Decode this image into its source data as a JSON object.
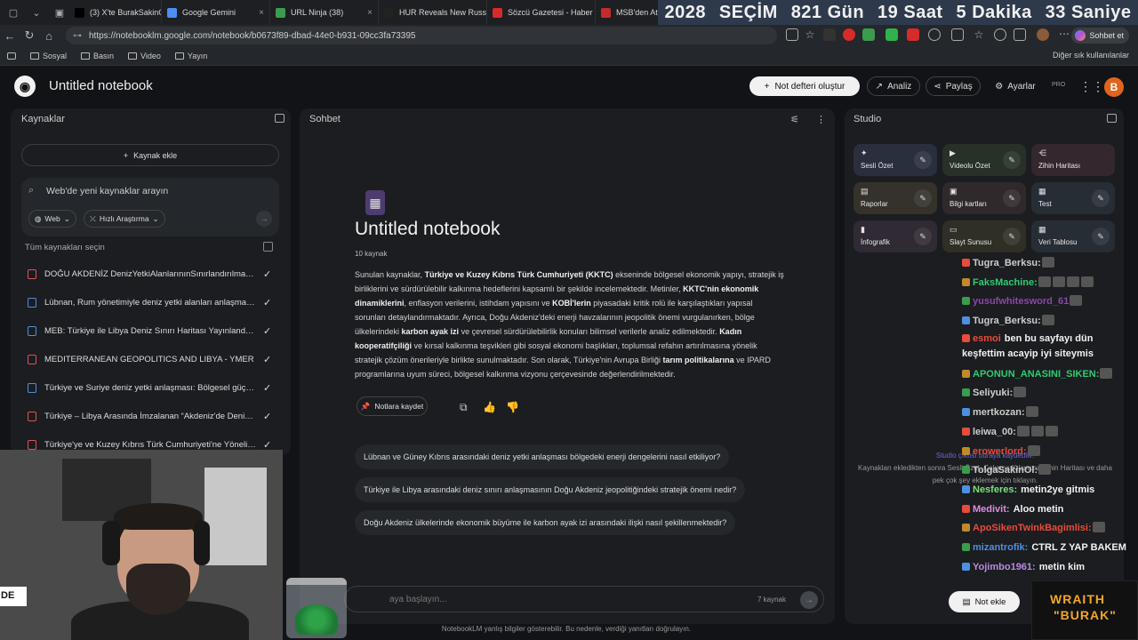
{
  "browser": {
    "tabs": [
      {
        "title": "(3) X'te BurakSakinOl: ",
        "color": "#000000"
      },
      {
        "title": "Google Gemini",
        "color": "#4c8df6"
      },
      {
        "title": "URL Ninja (38)",
        "color": "#3a9c4c"
      },
      {
        "title": "HUR Reveals New Russ",
        "color": "#222222"
      },
      {
        "title": "Sözcü Gazetesi - Haber",
        "color": "#d62b2b"
      },
      {
        "title": "MSB'den Atina'ya",
        "color": "#c42b2b"
      }
    ],
    "url": "https://notebooklm.google.com/notebook/b0673f89-dbad-44e0-b931-09cc3fa73395",
    "sohbet_label": "Sohbet et",
    "bookmarks": [
      "Sosyal",
      "Basın",
      "Video",
      "Yayın"
    ],
    "other_bookmarks": "Diğer sık kullanılanlar"
  },
  "countdown": [
    "2028",
    "SEÇİM",
    "821 Gün",
    "19 Saat",
    "5 Dakika",
    "33 Saniye"
  ],
  "header": {
    "title": "Untitled notebook",
    "create_label": "Not defteri oluştur",
    "analiz_label": "Analiz",
    "paylas_label": "Paylaş",
    "ayarlar_label": "Ayarlar",
    "pro_label": "PRO",
    "avatar_letter": "B"
  },
  "sources": {
    "title": "Kaynaklar",
    "add_label": "Kaynak ekle",
    "search_placeholder": "Web'de yeni kaynaklar arayın",
    "web_chip": "Web",
    "research_chip": "Hızlı Araştırma",
    "select_all": "Tüm kaynakları seçin",
    "items": [
      {
        "label": "DOĞU AKDENİZ DenizYetkiAlanlarınınSınırlandırılması D...",
        "type": "pdf"
      },
      {
        "label": "Lübnan, Rum yönetimiyle deniz yetki alanları anlaşması...",
        "type": "doc"
      },
      {
        "label": "MEB: Türkiye ile Libya Deniz Sınırı Haritası Yayınlandı - ...",
        "type": "doc"
      },
      {
        "label": "MEDITERRANEAN GEOPOLITICS AND LIBYA - YMER",
        "type": "pdf"
      },
      {
        "label": "Türkiye ve Suriye deniz yetki anlaşması: Bölgesel güç d...",
        "type": "doc"
      },
      {
        "label": "Türkiye – Libya Arasında İmzalanan “Akdeniz'de Deniz ...",
        "type": "pdf"
      },
      {
        "label": "Türkiye'ye ve Kuzey Kıbrıs Türk Cumhuriyeti'ne Yönelik ...",
        "type": "pdf"
      }
    ]
  },
  "chat": {
    "title": "Sohbet",
    "notebook_title": "Untitled notebook",
    "source_count": "10 kaynak",
    "summary_parts": [
      {
        "t": "Sunulan kaynaklar, ",
        "b": false
      },
      {
        "t": "Türkiye ve Kuzey Kıbrıs Türk Cumhuriyeti (KKTC)",
        "b": true
      },
      {
        "t": " ekseninde bölgesel ekonomik yapıyı, stratejik iş birliklerini ve sürdürülebilir kalkınma hedeflerini kapsamlı bir şekilde incelemektedir. Metinler, ",
        "b": false
      },
      {
        "t": "KKTC'nin ekonomik dinamiklerini",
        "b": true
      },
      {
        "t": ", enflasyon verilerini, istihdam yapısını ve ",
        "b": false
      },
      {
        "t": "KOBİ'lerin",
        "b": true
      },
      {
        "t": " piyasadaki kritik rolü ile karşılaştıkları yapısal sorunları detaylandırmaktadır. Ayrıca, Doğu Akdeniz'deki enerji havzalarının jeopolitik önemi vurgulanırken, bölge ülkelerindeki ",
        "b": false
      },
      {
        "t": "karbon ayak izi",
        "b": true
      },
      {
        "t": " ve çevresel sürdürülebilirlik konuları bilimsel verilerle analiz edilmektedir. ",
        "b": false
      },
      {
        "t": "Kadın kooperatifçiliği",
        "b": true
      },
      {
        "t": " ve kırsal kalkınma teşvikleri gibi sosyal ekonomi başlıkları, toplumsal refahın artırılmasına yönelik stratejik çözüm önerileriyle birlikte sunulmaktadır. Son olarak, Türkiye'nin Avrupa Birliği ",
        "b": false
      },
      {
        "t": "tarım politikalarına",
        "b": true
      },
      {
        "t": " ve IPARD programlarına uyum süreci, bölgesel kalkınma vizyonu çerçevesinde değerlendirilmektedir.",
        "b": false
      }
    ],
    "save_label": "Notlara kaydet",
    "suggestions": [
      "Lübnan ve Güney Kıbrıs arasındaki deniz yetki anlaşması bölgedeki enerji dengelerini nasıl etkiliyor?",
      "Türkiye ile Libya arasındaki deniz sınırı anlaşmasının Doğu Akdeniz jeopolitiğindeki stratejik önemi nedir?",
      "Doğu Akdeniz ülkelerinde ekonomik büyüme ile karbon ayak izi arasındaki ilişki nasıl şekillenmektedir?"
    ],
    "input_placeholder": "aya başlayın...",
    "input_count": "7 kaynak",
    "disclaimer": "NotebookLM yanlış bilgiler gösterebilir. Bu nedenle, verdiği yanıtları doğrulayın."
  },
  "studio": {
    "title": "Studio",
    "tiles": [
      {
        "label": "Sesli Özet",
        "icon": "sparkle-icon",
        "color": "#2a2f3d"
      },
      {
        "label": "Videolu Özet",
        "icon": "video-icon",
        "color": "#263128"
      },
      {
        "label": "Zihin Haritası",
        "icon": "mindmap-icon",
        "color": "#34272e"
      },
      {
        "label": "Raporlar",
        "icon": "report-icon",
        "color": "#34322a"
      },
      {
        "label": "Bilgi kartları",
        "icon": "cards-icon",
        "color": "#30292c"
      },
      {
        "label": "Test",
        "icon": "quiz-icon",
        "color": "#272d35"
      },
      {
        "label": "İnfografik",
        "icon": "chart-icon",
        "color": "#2f2a34"
      },
      {
        "label": "Slayt Sunusu",
        "icon": "slides-icon",
        "color": "#302f26"
      },
      {
        "label": "Veri Tablosu",
        "icon": "table-icon",
        "color": "#272d35"
      }
    ],
    "output_note_1": "Studio çıktısı buraya kaydedilir.",
    "output_note_2": "Kaynakları ekledikten sonra Sesli Özet, Çalışma Kılavuzu, Zihin Haritası ve daha pek çok şey eklemek için tıklayın.",
    "add_note_label": "Not ekle"
  },
  "stream_chat": [
    {
      "user": "Tugra_Berksu:",
      "text": "",
      "color": "#cccccc"
    },
    {
      "user": "FaksMachine:",
      "text": "",
      "color": "#2ecc71"
    },
    {
      "user": "yusufwhitesword_61",
      "text": "",
      "color": "#8e44ad"
    },
    {
      "user": "Tugra_Berksu:",
      "text": "",
      "color": "#cccccc"
    },
    {
      "user": "esmoi",
      "text": "ben bu sayfayı dün keşfettim acayip iyi siteymis",
      "color": "#e74c3c"
    },
    {
      "user": "APONUN_ANASINI_SIKEN:",
      "text": "",
      "color": "#2ecc71"
    },
    {
      "user": "Seliyuki:",
      "text": "",
      "color": "#cccccc"
    },
    {
      "user": "mertkozan:",
      "text": "",
      "color": "#cccccc"
    },
    {
      "user": "leiwa_00:",
      "text": "",
      "color": "#cccccc"
    },
    {
      "user": "erowerlord:",
      "text": "",
      "color": "#e74c3c"
    },
    {
      "user": "TolgaSakinOl:",
      "text": "",
      "color": "#cccccc"
    },
    {
      "user": "Nesferes:",
      "text": "metin2ye gitmis",
      "color": "#7be07b"
    },
    {
      "user": "Medivit:",
      "text": "Aloo metin",
      "color": "#e08be0"
    },
    {
      "user": "ApoSikenTwinkBagimlisi:",
      "text": "",
      "color": "#e74c3c"
    },
    {
      "user": "mizantrofik:",
      "text": "CTRL Z YAP BAKEM",
      "color": "#4f8fe0"
    },
    {
      "user": "Yojimbo1961:",
      "text": "metin kim",
      "color": "#b98be0"
    }
  ],
  "overlay_logo": [
    "WRAITH",
    "\"BURAK\""
  ],
  "webcam_tag": "DE"
}
